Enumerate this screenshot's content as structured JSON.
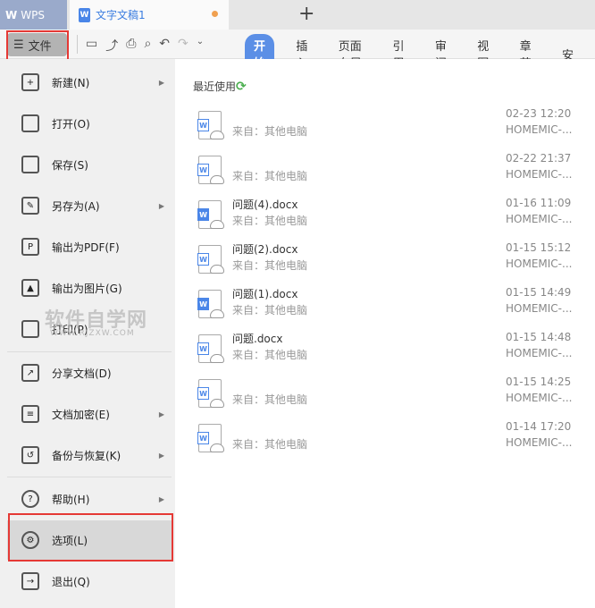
{
  "app": {
    "name": "WPS",
    "doc_tab": "文字文稿1",
    "new_tab": "+"
  },
  "toolbar": {
    "file_label": "文件",
    "tabs": [
      "开始",
      "插入",
      "页面布局",
      "引用",
      "审阅",
      "视图",
      "章节",
      "安"
    ]
  },
  "menu": [
    {
      "label": "新建(N)",
      "icon": "new-icon",
      "arrow": true
    },
    {
      "label": "打开(O)",
      "icon": "folder-icon",
      "arrow": false
    },
    {
      "label": "保存(S)",
      "icon": "save-icon",
      "arrow": false
    },
    {
      "label": "另存为(A)",
      "icon": "save-as-icon",
      "arrow": true
    },
    {
      "label": "输出为PDF(F)",
      "icon": "pdf-icon",
      "arrow": false
    },
    {
      "label": "输出为图片(G)",
      "icon": "image-icon",
      "arrow": false
    },
    {
      "label": "打印(P)",
      "icon": "print-icon",
      "arrow": false
    },
    {
      "label": "分享文档(D)",
      "icon": "share-icon",
      "arrow": false
    },
    {
      "label": "文档加密(E)",
      "icon": "encrypt-icon",
      "arrow": true
    },
    {
      "label": "备份与恢复(K)",
      "icon": "backup-icon",
      "arrow": true
    },
    {
      "label": "帮助(H)",
      "icon": "help-icon",
      "arrow": true
    },
    {
      "label": "选项(L)",
      "icon": "gear-icon",
      "arrow": false
    },
    {
      "label": "退出(Q)",
      "icon": "exit-icon",
      "arrow": false
    }
  ],
  "watermark": {
    "text": "软件自学网",
    "url": "WWW.RJZXW.COM"
  },
  "recent": {
    "title": "最近使用",
    "files": [
      {
        "name": "",
        "source": "来自：其他电脑",
        "time": "02-23 12:20",
        "device": "HOMEMIC-..."
      },
      {
        "name": "",
        "source": "来自：其他电脑",
        "time": "02-22 21:37",
        "device": "HOMEMIC-..."
      },
      {
        "name": "问题(4).docx",
        "source": "来自：其他电脑",
        "time": "01-16 11:09",
        "device": "HOMEMIC-..."
      },
      {
        "name": "问题(2).docx",
        "source": "来自：其他电脑",
        "time": "01-15 15:12",
        "device": "HOMEMIC-..."
      },
      {
        "name": "问题(1).docx",
        "source": "来自：其他电脑",
        "time": "01-15 14:49",
        "device": "HOMEMIC-..."
      },
      {
        "name": "问题.docx",
        "source": "来自：其他电脑",
        "time": "01-15 14:48",
        "device": "HOMEMIC-..."
      },
      {
        "name": "",
        "source": "来自：其他电脑",
        "time": "01-15 14:25",
        "device": "HOMEMIC-..."
      },
      {
        "name": "",
        "source": "来自：其他电脑",
        "time": "01-14 17:20",
        "device": "HOMEMIC-..."
      }
    ]
  }
}
